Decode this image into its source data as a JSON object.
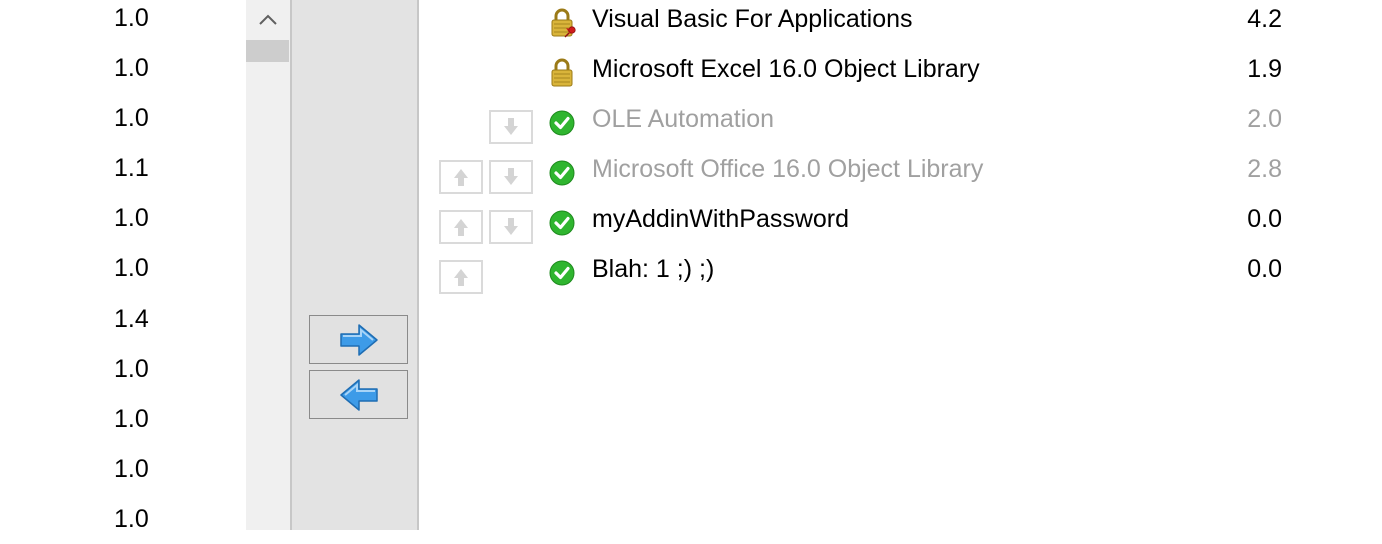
{
  "available_references": {
    "versions": [
      "1.0",
      "1.0",
      "1.0",
      "1.1",
      "1.0",
      "1.0",
      "1.4",
      "1.0",
      "1.0",
      "1.0",
      "1.0"
    ]
  },
  "scrollbar": {
    "up_icon": "chevron-up-icon"
  },
  "move_buttons": {
    "add_icon": "arrow-right-icon",
    "remove_icon": "arrow-left-icon"
  },
  "selected_references": [
    {
      "name": "Visual Basic For Applications",
      "version": "4.2",
      "icon": "lock-pin-icon",
      "enabled": true
    },
    {
      "name": "Microsoft Excel 16.0 Object Library",
      "version": "1.9",
      "icon": "lock-icon",
      "enabled": true
    },
    {
      "name": "OLE Automation",
      "version": "2.0",
      "icon": "check-icon",
      "enabled": false
    },
    {
      "name": "Microsoft Office 16.0 Object Library",
      "version": "2.8",
      "icon": "check-icon",
      "enabled": false
    },
    {
      "name": "myAddinWithPassword",
      "version": "0.0",
      "icon": "check-icon",
      "enabled": true
    },
    {
      "name": "Blah: 1 ;) ;)",
      "version": "0.0",
      "icon": "check-icon",
      "enabled": true
    }
  ],
  "colors": {
    "check_green": "#2fb52f",
    "lock_gold": "#c9a227",
    "arrow_blue": "#3d9be8",
    "disabled_text": "#a0a0a0"
  }
}
